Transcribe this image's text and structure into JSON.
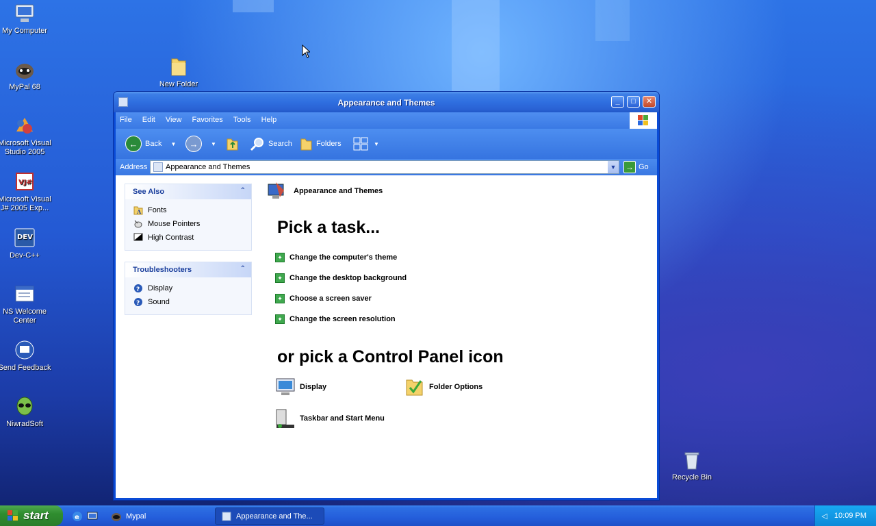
{
  "desktop": {
    "icons": [
      {
        "label": "My Computer",
        "icon": "my-computer-icon"
      },
      {
        "label": "MyPal 68",
        "icon": "mypal-icon"
      },
      {
        "label": "Microsoft Visual Studio 2005",
        "icon": "visual-studio-icon"
      },
      {
        "label": "Microsoft Visual J# 2005 Exp...",
        "icon": "visual-j-icon"
      },
      {
        "label": "Dev-C++",
        "icon": "dev-cpp-icon"
      },
      {
        "label": "NS Welcome Center",
        "icon": "ns-welcome-icon"
      },
      {
        "label": "Send Feedback",
        "icon": "feedback-icon"
      },
      {
        "label": "NiwradSoft",
        "icon": "alien-icon"
      },
      {
        "label": "New Folder",
        "icon": "folder-icon"
      },
      {
        "label": "Recycle Bin",
        "icon": "recycle-bin-icon"
      }
    ]
  },
  "window": {
    "title": "Appearance and Themes",
    "menu": [
      "File",
      "Edit",
      "View",
      "Favorites",
      "Tools",
      "Help"
    ],
    "toolbar": {
      "back": "Back",
      "search": "Search",
      "folders": "Folders"
    },
    "address": {
      "label": "Address",
      "value": "Appearance and Themes",
      "go": "Go"
    },
    "see_also": {
      "title": "See Also",
      "items": [
        "Fonts",
        "Mouse Pointers",
        "High Contrast"
      ]
    },
    "troubleshooters": {
      "title": "Troubleshooters",
      "items": [
        "Display",
        "Sound"
      ]
    },
    "header": "Appearance and Themes",
    "pick_task": "Pick a task...",
    "tasks": [
      "Change the computer's theme",
      "Change the desktop background",
      "Choose a screen saver",
      "Change the screen resolution"
    ],
    "pick_icon": "or pick a Control Panel icon",
    "cp_icons": [
      "Display",
      "Folder Options",
      "Taskbar and Start Menu"
    ]
  },
  "taskbar": {
    "start": "start",
    "items": [
      "Mypal",
      "Appearance and The..."
    ],
    "clock": "10:09 PM"
  },
  "colors": {
    "accent": "#245edb",
    "start_green": "#2f8d2f",
    "task_green": "#3fa84e"
  }
}
